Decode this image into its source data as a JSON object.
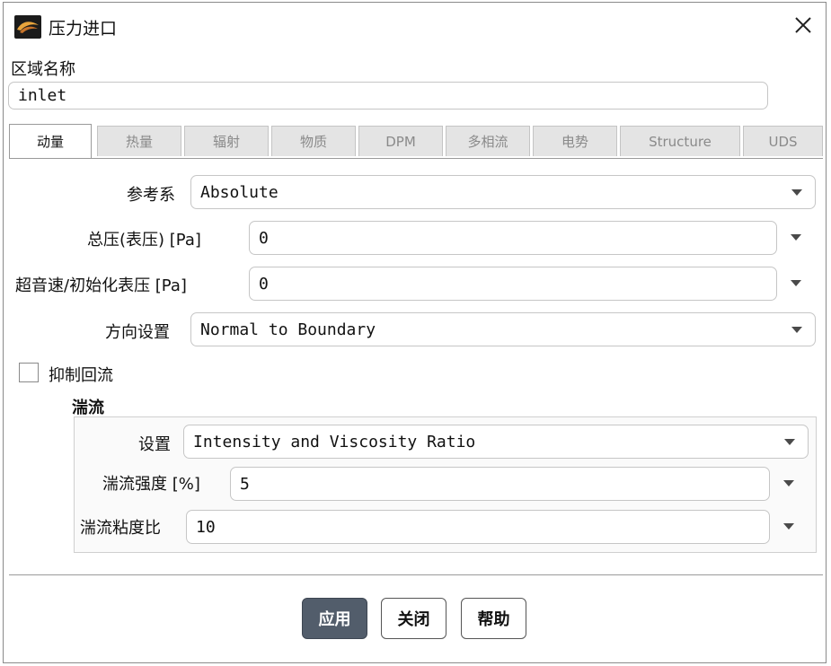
{
  "window": {
    "title": "压力进口"
  },
  "zone": {
    "label": "区域名称",
    "value": "inlet"
  },
  "tabs": [
    {
      "label": "动量",
      "active": true
    },
    {
      "label": "热量",
      "active": false
    },
    {
      "label": "辐射",
      "active": false
    },
    {
      "label": "物质",
      "active": false
    },
    {
      "label": "DPM",
      "active": false
    },
    {
      "label": "多相流",
      "active": false
    },
    {
      "label": "电势",
      "active": false
    },
    {
      "label": "Structure",
      "active": false
    },
    {
      "label": "UDS",
      "active": false
    }
  ],
  "momentum": {
    "reference_frame": {
      "label": "参考系",
      "value": "Absolute"
    },
    "total_pressure": {
      "label": "总压(表压) [Pa]",
      "value": "0"
    },
    "supersonic_pressure": {
      "label": "超音速/初始化表压 [Pa]",
      "value": "0"
    },
    "direction": {
      "label": "方向设置",
      "value": "Normal to Boundary"
    },
    "prevent_backflow": {
      "label": "抑制回流",
      "checked": false
    }
  },
  "turbulence": {
    "heading": "湍流",
    "method": {
      "label": "设置",
      "value": "Intensity and Viscosity Ratio"
    },
    "intensity": {
      "label": "湍流强度 [%]",
      "value": "5"
    },
    "viscosity_ratio": {
      "label": "湍流粘度比",
      "value": "10"
    }
  },
  "buttons": {
    "apply": "应用",
    "close": "关闭",
    "help": "帮助"
  },
  "colors": {
    "primary_button": "#525d6b",
    "inactive_tab": "#e4e4e4",
    "group_background": "#fafafa"
  },
  "icons": {
    "app": "fluent-app-icon",
    "close": "close-icon",
    "dropdown": "chevron-down-icon"
  }
}
